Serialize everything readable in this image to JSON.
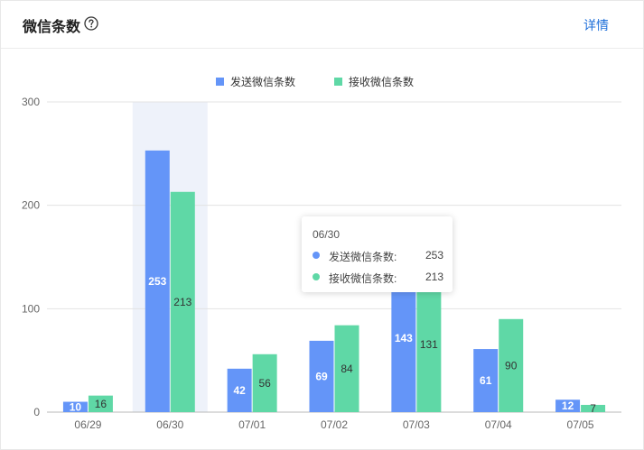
{
  "header": {
    "title": "微信条数",
    "detail_label": "详情"
  },
  "colors": {
    "send": "#6495f8",
    "receive": "#5fd8a6",
    "highlight": "#eef2fa",
    "link": "#1e6fd9"
  },
  "chart_data": {
    "type": "bar",
    "categories": [
      "06/29",
      "06/30",
      "07/01",
      "07/02",
      "07/03",
      "07/04",
      "07/05"
    ],
    "series": [
      {
        "name": "发送微信条数",
        "values": [
          10,
          253,
          42,
          69,
          143,
          61,
          12
        ]
      },
      {
        "name": "接收微信条数",
        "values": [
          16,
          213,
          56,
          84,
          131,
          90,
          7
        ]
      }
    ],
    "ylim": [
      0,
      300
    ],
    "yticks": [
      0,
      100,
      200,
      300
    ],
    "grid": true,
    "legend_position": "top-center",
    "highlighted_category": "06/30"
  },
  "tooltip": {
    "date": "06/30",
    "rows": [
      {
        "label": "发送微信条数:",
        "value": "253"
      },
      {
        "label": "接收微信条数:",
        "value": "213"
      }
    ]
  }
}
